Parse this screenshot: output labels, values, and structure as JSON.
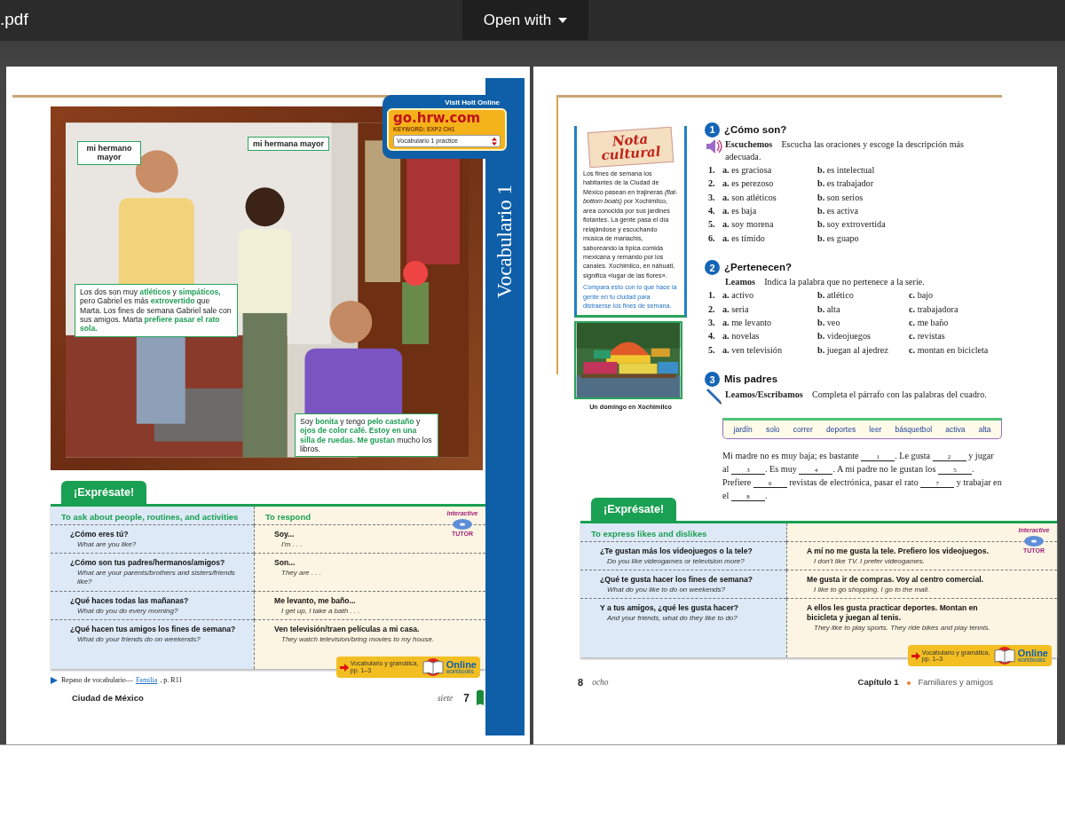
{
  "viewer": {
    "file_name": ".pdf",
    "open_with": "Open with"
  },
  "left_page": {
    "photo": {
      "labels": [
        "mi hermano mayor",
        "mi hermana mayor"
      ],
      "captions": [
        "Los dos son muy **atléticos** y **simpáticos,** pero Gabriel es más **extrovertido** que Marta. Los fines de semana Gabriel sale con sus amigos. Marta **prefiere pasar el rato sola.**",
        "Soy **bonita** y tengo **pelo castaño** y **ojos de color café. Estoy en una silla de ruedas. Me gustan** mucho los libros."
      ]
    },
    "online_badge": {
      "heading": "Visit Holt Online",
      "site": "go.hrw.com",
      "keyword": "KEYWORD: EXP2 CH1",
      "select_value": "Vocabulario 1 practice"
    },
    "side_tab": "Vocabulario 1",
    "expresate": {
      "tab": "¡Exprésate!",
      "headers": [
        "To ask about people, routines, and activities",
        "To respond"
      ],
      "tutor": {
        "top": "Interactive",
        "bottom": "TUTOR"
      },
      "rows": [
        {
          "question": "¿Cómo eres tú?",
          "question_en": "What are you like?",
          "answer": "Soy...",
          "answer_en": "I'm . . ."
        },
        {
          "question": "¿Cómo son tus padres/hermanos/amigos?",
          "question_en": "What are your parents/brothers and sisters/friends like?",
          "answer": "Son...",
          "answer_en": "They are . . ."
        },
        {
          "question": "¿Qué haces todas las mañanas?",
          "question_en": "What do you do every morning?",
          "answer": "Me levanto, me baño...",
          "answer_en": "I get up, I take a bath . . ."
        },
        {
          "question": "¿Qué hacen tus amigos los fines de semana?",
          "question_en": "What do your friends do on weekends?",
          "answer": "Ven televisión/traen películas a mi casa.",
          "answer_en": "They watch television/bring movies to my house."
        }
      ],
      "workbook": {
        "note": "Vocabulario y gramática, pp. 1–3",
        "title": "Online",
        "subtitle": "workbooks"
      }
    },
    "review": {
      "text": "Repaso de vocabulario—",
      "link": "Familia",
      "after": ", p. R11"
    },
    "footer": {
      "location": "Ciudad de México",
      "page_word": "siete",
      "page_number": "7"
    }
  },
  "right_page": {
    "note": {
      "title": "Nota cultural",
      "text": "Los fines de semana los habitantes de la Ciudad de México pasean en trajineras *(flat-bottom boats)* por Xochimilco, area conocida por sus jardines flotantes. La gente pasa el día relajándose y escuchando música de mariachis, saboreando la típica comida mexicana y remando por los canales. Xochimilco, en náhuatl, significa «lugar de las flores».",
      "prompt": "Compara esto con lo que hace la gente en tu ciudad para distraerse los fines de semana."
    },
    "picture": {
      "caption": "Un domingo en Xochimilco"
    },
    "exercises": [
      {
        "number": "1",
        "title": "¿Cómo son?",
        "kind": "listen",
        "skill": "Escuchemos",
        "instruction": "Escucha las oraciones y escoge la descripción más adecuada.",
        "items": [
          {
            "number": "1.",
            "options": [
              {
                "letter": "a.",
                "text": "es graciosa"
              },
              {
                "letter": "b.",
                "text": "es intelectual"
              }
            ]
          },
          {
            "number": "2.",
            "options": [
              {
                "letter": "a.",
                "text": "es perezoso"
              },
              {
                "letter": "b.",
                "text": "es trabajador"
              }
            ]
          },
          {
            "number": "3.",
            "options": [
              {
                "letter": "a.",
                "text": "son atléticos"
              },
              {
                "letter": "b.",
                "text": "son serios"
              }
            ]
          },
          {
            "number": "4.",
            "options": [
              {
                "letter": "a.",
                "text": "es baja"
              },
              {
                "letter": "b.",
                "text": "es activa"
              }
            ]
          },
          {
            "number": "5.",
            "options": [
              {
                "letter": "a.",
                "text": "soy morena"
              },
              {
                "letter": "b.",
                "text": "soy extrovertida"
              }
            ]
          },
          {
            "number": "6.",
            "options": [
              {
                "letter": "a.",
                "text": "es tímido"
              },
              {
                "letter": "b.",
                "text": "es guapo"
              }
            ]
          }
        ]
      },
      {
        "number": "2",
        "title": "¿Pertenecen?",
        "kind": "read",
        "skill": "Leamos",
        "instruction": "Indica la palabra que no pertenece a la serie.",
        "items": [
          {
            "number": "1.",
            "options": [
              {
                "letter": "a.",
                "text": "activo"
              },
              {
                "letter": "b.",
                "text": "atlético"
              },
              {
                "letter": "c.",
                "text": "bajo"
              }
            ]
          },
          {
            "number": "2.",
            "options": [
              {
                "letter": "a.",
                "text": "seria"
              },
              {
                "letter": "b.",
                "text": "alta"
              },
              {
                "letter": "c.",
                "text": "trabajadora"
              }
            ]
          },
          {
            "number": "3.",
            "options": [
              {
                "letter": "a.",
                "text": "me levanto"
              },
              {
                "letter": "b.",
                "text": "veo"
              },
              {
                "letter": "c.",
                "text": "me baño"
              }
            ]
          },
          {
            "number": "4.",
            "options": [
              {
                "letter": "a.",
                "text": "novelas"
              },
              {
                "letter": "b.",
                "text": "videojuegos"
              },
              {
                "letter": "c.",
                "text": "revistas"
              }
            ]
          },
          {
            "number": "5.",
            "options": [
              {
                "letter": "a.",
                "text": "ven televisión"
              },
              {
                "letter": "b.",
                "text": "juegan al ajedrez"
              },
              {
                "letter": "c.",
                "text": "montan en bicicleta"
              }
            ]
          }
        ]
      },
      {
        "number": "3",
        "title": "Mis padres",
        "kind": "write",
        "skill": "Leamos/Escribamos",
        "instruction": "Completa el párrafo con las palabras del cuadro.",
        "words": [
          "jardín",
          "solo",
          "correr",
          "deportes",
          "leer",
          "básquetbol",
          "activa",
          "alta"
        ],
        "paragraph": [
          {
            "kind": "text",
            "text": "Mi madre no es muy baja; es bastante "
          },
          {
            "kind": "blank",
            "text": "1"
          },
          {
            "kind": "text",
            "text": ". Le gusta "
          },
          {
            "kind": "blank",
            "text": "2"
          },
          {
            "kind": "text",
            "text": " y jugar al "
          },
          {
            "kind": "blank",
            "text": "3"
          },
          {
            "kind": "text",
            "text": ". Es muy "
          },
          {
            "kind": "blank",
            "text": "4"
          },
          {
            "kind": "text",
            "text": ". A mi padre no le gustan los "
          },
          {
            "kind": "blank",
            "text": "5"
          },
          {
            "kind": "text",
            "text": ". Prefiere "
          },
          {
            "kind": "blank",
            "text": "6"
          },
          {
            "kind": "text",
            "text": " revistas de electrónica, pasar el rato "
          },
          {
            "kind": "blank",
            "text": "7"
          },
          {
            "kind": "text",
            "text": " y trabajar en el "
          },
          {
            "kind": "blank",
            "text": "8"
          },
          {
            "kind": "text",
            "text": "."
          }
        ]
      }
    ],
    "expresate": {
      "tab": "¡Exprésate!",
      "headers": [
        "To express likes and dislikes"
      ],
      "tutor": {
        "top": "Interactive",
        "bottom": "TUTOR"
      },
      "rows": [
        {
          "question": "¿Te gustan más los videojuegos o la tele?",
          "question_en": "Do you like videogames or television more?",
          "answer": "A mí no me gusta la tele. Prefiero los videojuegos.",
          "answer_en": "I don't like TV. I prefer videogames."
        },
        {
          "question": "¿Qué te gusta hacer los fines de semana?",
          "question_en": "What do you like to do on weekends?",
          "answer": "Me gusta ir de compras. Voy al centro comercial.",
          "answer_en": "I like to go shopping. I go to the mall."
        },
        {
          "question": "Y a tus amigos, ¿qué les gusta hacer?",
          "question_en": "And your friends, what do they like to do?",
          "answer": "A ellos les gusta practicar deportes. Montan en bicicleta y juegan al tenis.",
          "answer_en": "They like to play sports. They ride bikes and play tennis."
        }
      ],
      "workbook": {
        "note": "Vocabulario y gramática, pp. 1–3",
        "title": "Online",
        "subtitle": "workbooks"
      }
    },
    "footer": {
      "page_number": "8",
      "page_word": "ocho",
      "chapter": "Capítulo 1",
      "chapter_title": "Familiares y amigos"
    }
  }
}
